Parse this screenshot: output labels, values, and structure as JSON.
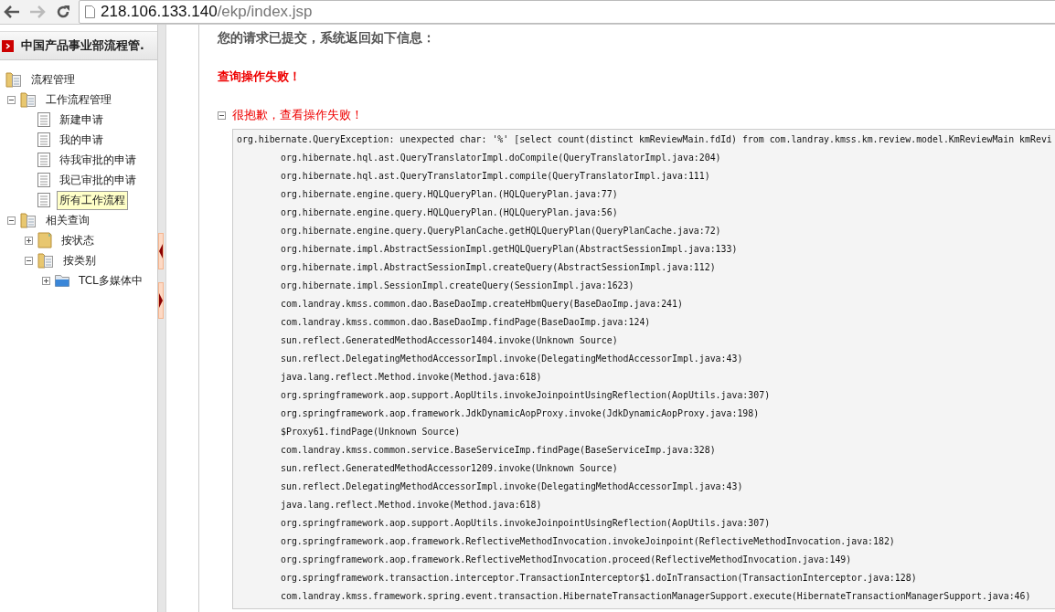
{
  "browser": {
    "url_host": "218.106.133.140",
    "url_path": "/ekp/index.jsp"
  },
  "sidebar": {
    "title": "中国产品事业部流程管.",
    "tree": [
      {
        "label": "流程管理",
        "kind": "folder",
        "selected": false,
        "children": [
          {
            "label": "工作流程管理",
            "kind": "folder",
            "expanded": true,
            "selected": false,
            "children": [
              {
                "label": "新建申请",
                "kind": "doc",
                "selected": false
              },
              {
                "label": "我的申请",
                "kind": "doc",
                "selected": false
              },
              {
                "label": "待我审批的申请",
                "kind": "doc",
                "selected": false
              },
              {
                "label": "我已审批的申请",
                "kind": "doc",
                "selected": false
              },
              {
                "label": "所有工作流程",
                "kind": "doc",
                "selected": true
              }
            ]
          },
          {
            "label": "相关查询",
            "kind": "folder",
            "expanded": true,
            "selected": false,
            "children": [
              {
                "label": "按状态",
                "kind": "closed-folder",
                "expanded": false,
                "selected": false
              },
              {
                "label": "按类别",
                "kind": "folder",
                "expanded": true,
                "selected": false,
                "children": [
                  {
                    "label": "TCL多媒体中",
                    "kind": "blue-folder",
                    "expanded": false,
                    "selected": false
                  }
                ]
              }
            ]
          }
        ]
      }
    ]
  },
  "main": {
    "message": "您的请求已提交，系统返回如下信息：",
    "error": "查询操作失败！",
    "detail_title": "很抱歉，查看操作失败！",
    "detail_expanded": true,
    "stack": [
      {
        "text": "org.hibernate.QueryException: unexpected char: '%' [select count(distinct kmReviewMain.fdId) from com.landray.kmss.km.review.model.KmReviewMain kmRevi",
        "indent": false
      },
      {
        "text": "org.hibernate.hql.ast.QueryTranslatorImpl.doCompile(QueryTranslatorImpl.java:204)",
        "indent": true
      },
      {
        "text": "org.hibernate.hql.ast.QueryTranslatorImpl.compile(QueryTranslatorImpl.java:111)",
        "indent": true
      },
      {
        "text": "org.hibernate.engine.query.HQLQueryPlan.(HQLQueryPlan.java:77)",
        "indent": true
      },
      {
        "text": "org.hibernate.engine.query.HQLQueryPlan.(HQLQueryPlan.java:56)",
        "indent": true
      },
      {
        "text": "org.hibernate.engine.query.QueryPlanCache.getHQLQueryPlan(QueryPlanCache.java:72)",
        "indent": true
      },
      {
        "text": "org.hibernate.impl.AbstractSessionImpl.getHQLQueryPlan(AbstractSessionImpl.java:133)",
        "indent": true
      },
      {
        "text": "org.hibernate.impl.AbstractSessionImpl.createQuery(AbstractSessionImpl.java:112)",
        "indent": true
      },
      {
        "text": "org.hibernate.impl.SessionImpl.createQuery(SessionImpl.java:1623)",
        "indent": true
      },
      {
        "text": "com.landray.kmss.common.dao.BaseDaoImp.createHbmQuery(BaseDaoImp.java:241)",
        "indent": true
      },
      {
        "text": "com.landray.kmss.common.dao.BaseDaoImp.findPage(BaseDaoImp.java:124)",
        "indent": true
      },
      {
        "text": "sun.reflect.GeneratedMethodAccessor1404.invoke(Unknown Source)",
        "indent": true
      },
      {
        "text": "sun.reflect.DelegatingMethodAccessorImpl.invoke(DelegatingMethodAccessorImpl.java:43)",
        "indent": true
      },
      {
        "text": "java.lang.reflect.Method.invoke(Method.java:618)",
        "indent": true
      },
      {
        "text": "org.springframework.aop.support.AopUtils.invokeJoinpointUsingReflection(AopUtils.java:307)",
        "indent": true
      },
      {
        "text": "org.springframework.aop.framework.JdkDynamicAopProxy.invoke(JdkDynamicAopProxy.java:198)",
        "indent": true
      },
      {
        "text": "$Proxy61.findPage(Unknown Source)",
        "indent": true
      },
      {
        "text": "com.landray.kmss.common.service.BaseServiceImp.findPage(BaseServiceImp.java:328)",
        "indent": true
      },
      {
        "text": "sun.reflect.GeneratedMethodAccessor1209.invoke(Unknown Source)",
        "indent": true
      },
      {
        "text": "sun.reflect.DelegatingMethodAccessorImpl.invoke(DelegatingMethodAccessorImpl.java:43)",
        "indent": true
      },
      {
        "text": "java.lang.reflect.Method.invoke(Method.java:618)",
        "indent": true
      },
      {
        "text": "org.springframework.aop.support.AopUtils.invokeJoinpointUsingReflection(AopUtils.java:307)",
        "indent": true
      },
      {
        "text": "org.springframework.aop.framework.ReflectiveMethodInvocation.invokeJoinpoint(ReflectiveMethodInvocation.java:182)",
        "indent": true
      },
      {
        "text": "org.springframework.aop.framework.ReflectiveMethodInvocation.proceed(ReflectiveMethodInvocation.java:149)",
        "indent": true
      },
      {
        "text": "org.springframework.transaction.interceptor.TransactionInterceptor$1.doInTransaction(TransactionInterceptor.java:128)",
        "indent": true
      },
      {
        "text": "com.landray.kmss.framework.spring.event.transaction.HibernateTransactionManagerSupport.execute(HibernateTransactionManagerSupport.java:46)",
        "indent": true
      }
    ]
  }
}
